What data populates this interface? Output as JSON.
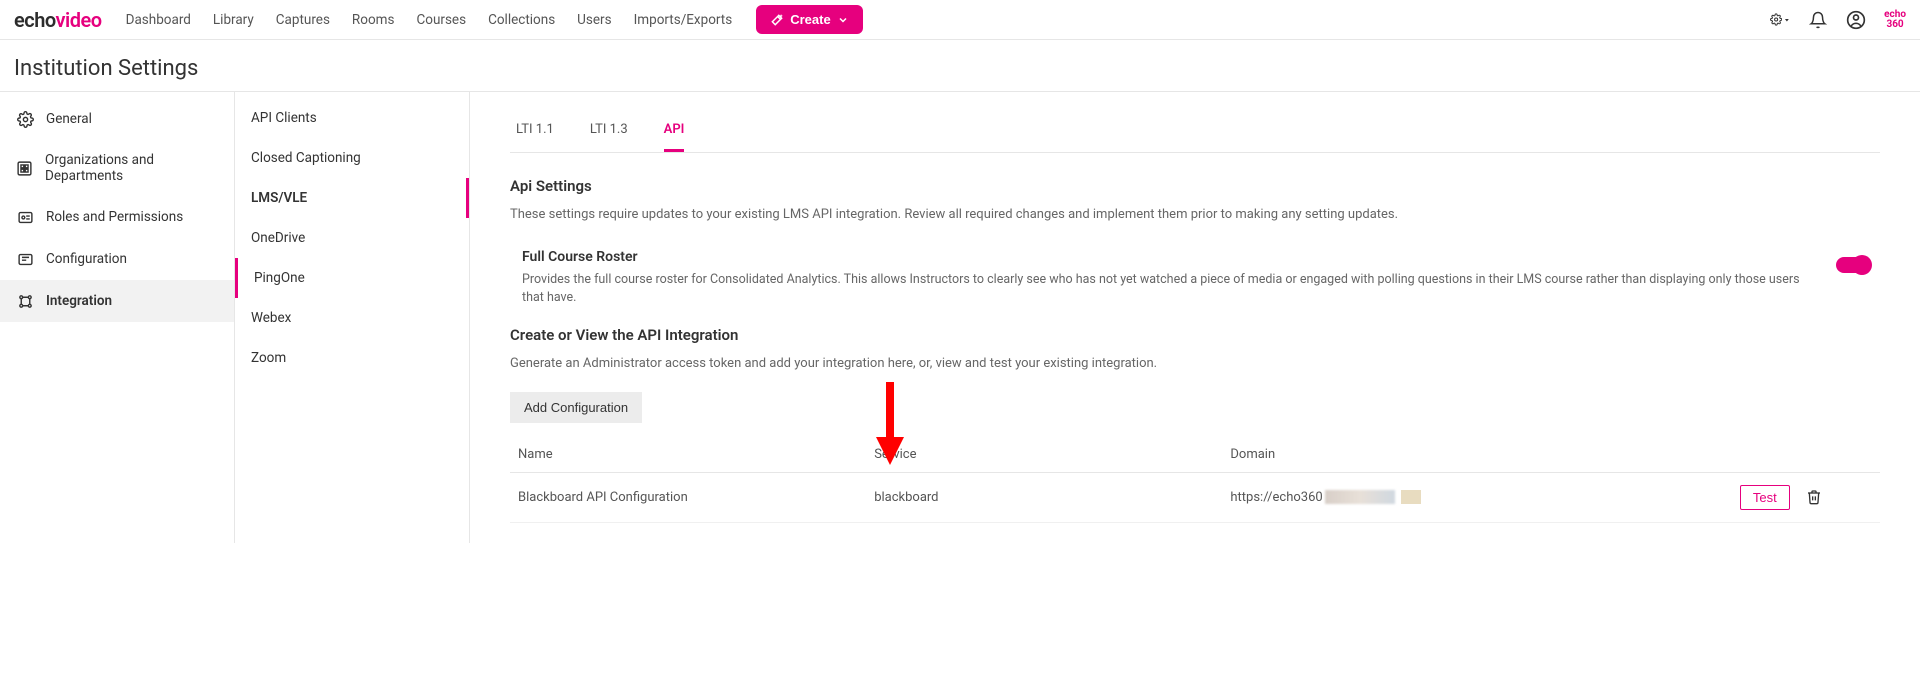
{
  "logo": {
    "part1": "echo",
    "part2": "video"
  },
  "topnav": [
    "Dashboard",
    "Library",
    "Captures",
    "Rooms",
    "Courses",
    "Collections",
    "Users",
    "Imports/Exports"
  ],
  "create_label": "Create",
  "page_title": "Institution Settings",
  "sidebar1": [
    {
      "label": "General",
      "icon": "gear"
    },
    {
      "label": "Organizations and Departments",
      "icon": "org"
    },
    {
      "label": "Roles and Permissions",
      "icon": "roles"
    },
    {
      "label": "Configuration",
      "icon": "config"
    },
    {
      "label": "Integration",
      "icon": "integration"
    }
  ],
  "sidebar1_active": 4,
  "sidebar2": [
    "API Clients",
    "Closed Captioning",
    "LMS/VLE",
    "OneDrive",
    "PingOne",
    "Webex",
    "Zoom"
  ],
  "sidebar2_active": 2,
  "tabs": [
    "LTI 1.1",
    "LTI 1.3",
    "API"
  ],
  "tabs_active": 2,
  "api_settings": {
    "title": "Api Settings",
    "desc": "These settings require updates to your existing LMS API integration. Review all required changes and implement them prior to making any setting updates.",
    "full_roster_title": "Full Course Roster",
    "full_roster_desc": "Provides the full course roster for Consolidated Analytics. This allows Instructors to clearly see who has not yet watched a piece of media or engaged with polling questions in their LMS course rather than displaying only those users that have.",
    "create_view_title": "Create or View the API Integration",
    "create_view_desc": "Generate an Administrator access token and add your integration here, or, view and test your existing integration.",
    "add_config_label": "Add Configuration",
    "columns": [
      "Name",
      "Service",
      "Domain"
    ],
    "rows": [
      {
        "name": "Blackboard API Configuration",
        "service": "blackboard",
        "domain": "https://echo360"
      }
    ],
    "test_label": "Test"
  },
  "small_logo": {
    "line1": "echo",
    "line2": "360"
  }
}
